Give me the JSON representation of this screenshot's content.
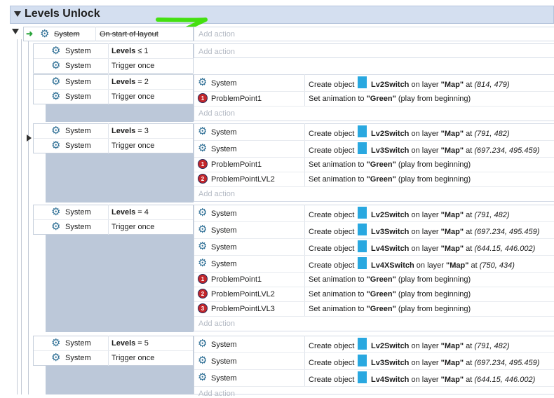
{
  "group": {
    "title": "Levels Unlock"
  },
  "strings": {
    "system": "System",
    "trigger_once": "Trigger once",
    "add_action": "Add action",
    "create_object": "Create object",
    "on_layer": "on layer",
    "at": "at",
    "set_animation_to": "Set animation to",
    "play_from_beginning": "(play from beginning)",
    "levels": "Levels",
    "le": "≤",
    "eq": "=",
    "layer_map": "\"Map\"",
    "green": "\"Green\""
  },
  "start_event": {
    "object": "System",
    "condition": "On start of layout",
    "action": "Add action"
  },
  "events": [
    {
      "condition_value": "1",
      "actions": []
    },
    {
      "condition_value": "2",
      "actions": [
        {
          "kind": "create",
          "object": "Lv2Switch",
          "coords": "(814, 479)"
        },
        {
          "kind": "anim",
          "object": "ProblemPoint1",
          "badge": "1"
        }
      ]
    },
    {
      "condition_value": "3",
      "actions": [
        {
          "kind": "create",
          "object": "Lv2Switch",
          "coords": "(791, 482)"
        },
        {
          "kind": "create",
          "object": "Lv3Switch",
          "coords": "(697.234, 495.459)"
        },
        {
          "kind": "anim",
          "object": "ProblemPoint1",
          "badge": "1"
        },
        {
          "kind": "anim",
          "object": "ProblemPointLVL2",
          "badge": "2"
        }
      ]
    },
    {
      "condition_value": "4",
      "actions": [
        {
          "kind": "create",
          "object": "Lv2Switch",
          "coords": "(791, 482)"
        },
        {
          "kind": "create",
          "object": "Lv3Switch",
          "coords": "(697.234, 495.459)"
        },
        {
          "kind": "create",
          "object": "Lv4Switch",
          "coords": "(644.15, 446.002)"
        },
        {
          "kind": "create",
          "object": "Lv4XSwitch",
          "coords": "(750, 434)"
        },
        {
          "kind": "anim",
          "object": "ProblemPoint1",
          "badge": "1"
        },
        {
          "kind": "anim",
          "object": "ProblemPointLVL2",
          "badge": "2"
        },
        {
          "kind": "anim",
          "object": "ProblemPointLVL3",
          "badge": "3"
        }
      ]
    },
    {
      "condition_value": "5",
      "actions": [
        {
          "kind": "create",
          "object": "Lv2Switch",
          "coords": "(791, 482)"
        },
        {
          "kind": "create",
          "object": "Lv3Switch",
          "coords": "(697.234, 495.459)"
        },
        {
          "kind": "create",
          "object": "Lv4Switch",
          "coords": "(644.15, 446.002)"
        }
      ]
    }
  ],
  "colors": {
    "header_bg": "#d4dff0",
    "event_bg": "#bcc8d9",
    "gear": "#2e6f95",
    "swatch": "#29a8e0",
    "badge": "#c3262a",
    "annotation": "#44e010",
    "start_arrow": "#2aa43c"
  },
  "icons": {
    "group_toggle": "triangle-down-icon",
    "system": "gear-icon",
    "sprite": "sprite-swatch-icon",
    "problem_point": "problem-point-badge-icon",
    "trigger": "green-arrow-icon",
    "expand": "triangle-right-icon",
    "annotation": "green-arrow-annotation"
  }
}
